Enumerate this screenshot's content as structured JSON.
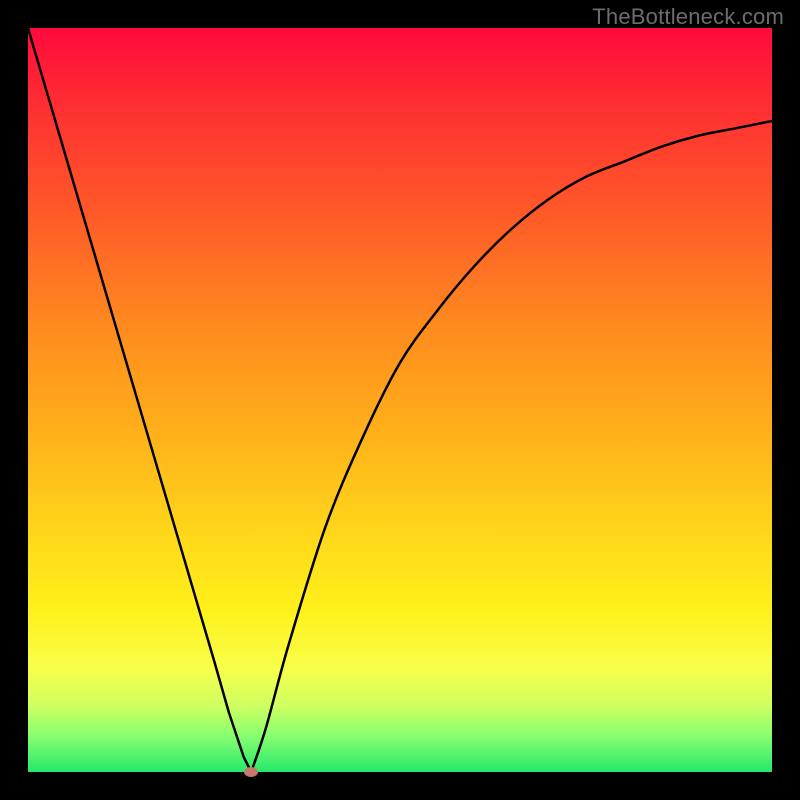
{
  "watermark": "TheBottleneck.com",
  "colors": {
    "frame": "#000000",
    "marker": "#c8786a",
    "curve_stroke": "#000000"
  },
  "chart_data": {
    "type": "line",
    "title": "",
    "xlabel": "",
    "ylabel": "",
    "xlim": [
      0,
      100
    ],
    "ylim": [
      0,
      100
    ],
    "grid": false,
    "legend": false,
    "series": [
      {
        "name": "bottleneck-curve",
        "x": [
          0,
          5,
          10,
          15,
          20,
          25,
          27,
          29,
          30,
          32,
          35,
          40,
          45,
          50,
          55,
          60,
          65,
          70,
          75,
          80,
          85,
          90,
          95,
          100
        ],
        "values": [
          100,
          83,
          66,
          49,
          32,
          15,
          8,
          2,
          0,
          6,
          17,
          33,
          45,
          55,
          62,
          68,
          73,
          77,
          80,
          82,
          84,
          85.5,
          86.5,
          87.5
        ]
      }
    ],
    "annotations": [
      {
        "name": "minimum-marker",
        "x": 30,
        "y": 0,
        "shape": "ellipse"
      }
    ],
    "background_gradient": {
      "direction": "vertical",
      "stops": [
        {
          "pos": 0,
          "color": "#ff0a3c"
        },
        {
          "pos": 25,
          "color": "#ff5a28"
        },
        {
          "pos": 55,
          "color": "#ffb21a"
        },
        {
          "pos": 78,
          "color": "#fff01a"
        },
        {
          "pos": 95,
          "color": "#8aff70"
        },
        {
          "pos": 100,
          "color": "#26e86b"
        }
      ]
    }
  }
}
